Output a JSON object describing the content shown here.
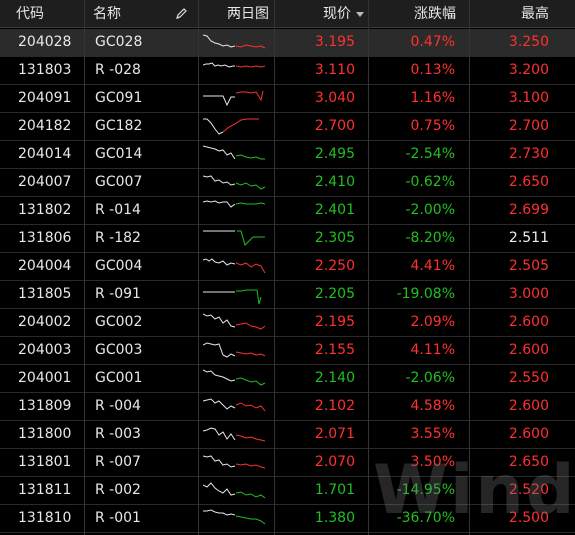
{
  "colors": {
    "up": "#ff3030",
    "down": "#1fc01f",
    "flat": "#eeeeee",
    "header_bg": "#1e1e1e",
    "selected_bg": "#2b2b2b"
  },
  "header": {
    "code": "代码",
    "name": "名称",
    "chart": "两日图",
    "price": "现价",
    "change_pct": "涨跌幅",
    "high": "最高",
    "edit_icon": "pencil-icon",
    "sort_icon": "sort-desc-icon"
  },
  "rows": [
    {
      "code": "204028",
      "name": "GC028",
      "price": "3.195",
      "pct": "0.47%",
      "high": "3.250",
      "price_color": "red",
      "pct_color": "red",
      "high_color": "red"
    },
    {
      "code": "131803",
      "name": "R -028",
      "price": "3.110",
      "pct": "0.13%",
      "high": "3.200",
      "price_color": "red",
      "pct_color": "red",
      "high_color": "red"
    },
    {
      "code": "204091",
      "name": "GC091",
      "price": "3.040",
      "pct": "1.16%",
      "high": "3.100",
      "price_color": "red",
      "pct_color": "red",
      "high_color": "red"
    },
    {
      "code": "204182",
      "name": "GC182",
      "price": "2.700",
      "pct": "0.75%",
      "high": "2.700",
      "price_color": "red",
      "pct_color": "red",
      "high_color": "red"
    },
    {
      "code": "204014",
      "name": "GC014",
      "price": "2.495",
      "pct": "-2.54%",
      "high": "2.730",
      "price_color": "green",
      "pct_color": "green",
      "high_color": "red"
    },
    {
      "code": "204007",
      "name": "GC007",
      "price": "2.410",
      "pct": "-0.62%",
      "high": "2.650",
      "price_color": "green",
      "pct_color": "green",
      "high_color": "red"
    },
    {
      "code": "131802",
      "name": "R -014",
      "price": "2.401",
      "pct": "-2.00%",
      "high": "2.699",
      "price_color": "green",
      "pct_color": "green",
      "high_color": "red"
    },
    {
      "code": "131806",
      "name": "R -182",
      "price": "2.305",
      "pct": "-8.20%",
      "high": "2.511",
      "price_color": "green",
      "pct_color": "green",
      "high_color": "white"
    },
    {
      "code": "204004",
      "name": "GC004",
      "price": "2.250",
      "pct": "4.41%",
      "high": "2.505",
      "price_color": "red",
      "pct_color": "red",
      "high_color": "red"
    },
    {
      "code": "131805",
      "name": "R -091",
      "price": "2.205",
      "pct": "-19.08%",
      "high": "3.000",
      "price_color": "green",
      "pct_color": "green",
      "high_color": "red"
    },
    {
      "code": "204002",
      "name": "GC002",
      "price": "2.195",
      "pct": "2.09%",
      "high": "2.600",
      "price_color": "red",
      "pct_color": "red",
      "high_color": "red"
    },
    {
      "code": "204003",
      "name": "GC003",
      "price": "2.155",
      "pct": "4.11%",
      "high": "2.600",
      "price_color": "red",
      "pct_color": "red",
      "high_color": "red"
    },
    {
      "code": "204001",
      "name": "GC001",
      "price": "2.140",
      "pct": "-2.06%",
      "high": "2.550",
      "price_color": "green",
      "pct_color": "green",
      "high_color": "red"
    },
    {
      "code": "131809",
      "name": "R -004",
      "price": "2.102",
      "pct": "4.58%",
      "high": "2.600",
      "price_color": "red",
      "pct_color": "red",
      "high_color": "red"
    },
    {
      "code": "131800",
      "name": "R -003",
      "price": "2.071",
      "pct": "3.55%",
      "high": "2.600",
      "price_color": "red",
      "pct_color": "red",
      "high_color": "red"
    },
    {
      "code": "131801",
      "name": "R -007",
      "price": "2.070",
      "pct": "3.50%",
      "high": "2.650",
      "price_color": "red",
      "pct_color": "red",
      "high_color": "red"
    },
    {
      "code": "131811",
      "name": "R -002",
      "price": "1.701",
      "pct": "-14.95%",
      "high": "2.520",
      "price_color": "green",
      "pct_color": "green",
      "high_color": "red"
    },
    {
      "code": "131810",
      "name": "R -001",
      "price": "1.380",
      "pct": "-36.70%",
      "high": "2.500",
      "price_color": "green",
      "pct_color": "green",
      "high_color": "red"
    }
  ],
  "watermark": {
    "text": "Wind"
  }
}
